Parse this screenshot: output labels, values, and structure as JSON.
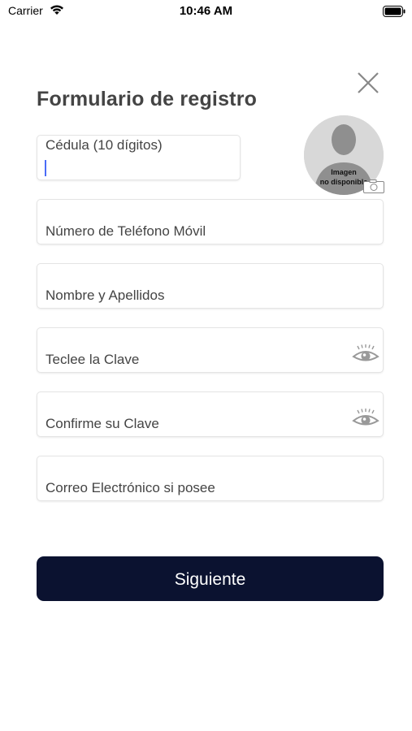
{
  "status_bar": {
    "carrier": "Carrier",
    "time": "10:46 AM"
  },
  "form": {
    "title": "Formulario de registro",
    "avatar": {
      "text_line1": "Imagen",
      "text_line2": "no disponible"
    },
    "fields": {
      "cedula": {
        "label": "Cédula (10 dígitos)",
        "value": ""
      },
      "phone": {
        "label": "Número de Teléfono Móvil",
        "value": ""
      },
      "name": {
        "label": "Nombre y Apellidos",
        "value": ""
      },
      "password": {
        "label": "Teclee la Clave",
        "value": ""
      },
      "confirm_password": {
        "label": "Confirme su Clave",
        "value": ""
      },
      "email": {
        "label": "Correo Electrónico si posee",
        "value": ""
      }
    },
    "next_label": "Siguiente"
  },
  "colors": {
    "primary_button": "#0b1230",
    "caret": "#4a6cf7",
    "title_text": "#444444"
  },
  "icons": [
    "wifi-icon",
    "battery-icon",
    "close-icon",
    "avatar-placeholder-icon",
    "camera-icon",
    "eye-icon"
  ]
}
